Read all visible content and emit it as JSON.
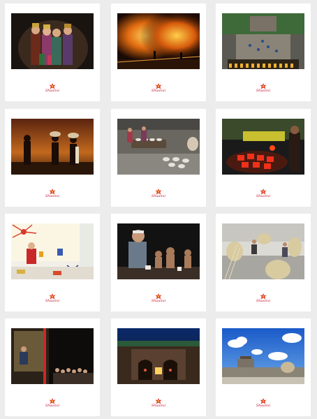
{
  "gallery": {
    "logo_text": "Shaanxi",
    "cards": [
      {
        "name": "opera-performers-photo",
        "logo": "Shaanxi"
      },
      {
        "name": "iron-flower-fireworks-photo",
        "logo": "Shaanxi"
      },
      {
        "name": "aerial-courtyard-performance-photo",
        "logo": "Shaanxi"
      },
      {
        "name": "farmers-sunset-photo",
        "logo": "Shaanxi"
      },
      {
        "name": "pottery-workshop-photo",
        "logo": "Shaanxi"
      },
      {
        "name": "glowing-kiln-photo",
        "logo": "Shaanxi"
      },
      {
        "name": "paper-cutting-artist-photo",
        "logo": "Shaanxi"
      },
      {
        "name": "clay-sculptor-photo",
        "logo": "Shaanxi"
      },
      {
        "name": "straw-weaving-workshop-photo",
        "logo": "Shaanxi"
      },
      {
        "name": "shadow-puppet-show-photo",
        "logo": "Shaanxi"
      },
      {
        "name": "cave-dwelling-night-photo",
        "logo": "Shaanxi"
      },
      {
        "name": "city-wall-sky-photo",
        "logo": "Shaanxi"
      }
    ]
  }
}
